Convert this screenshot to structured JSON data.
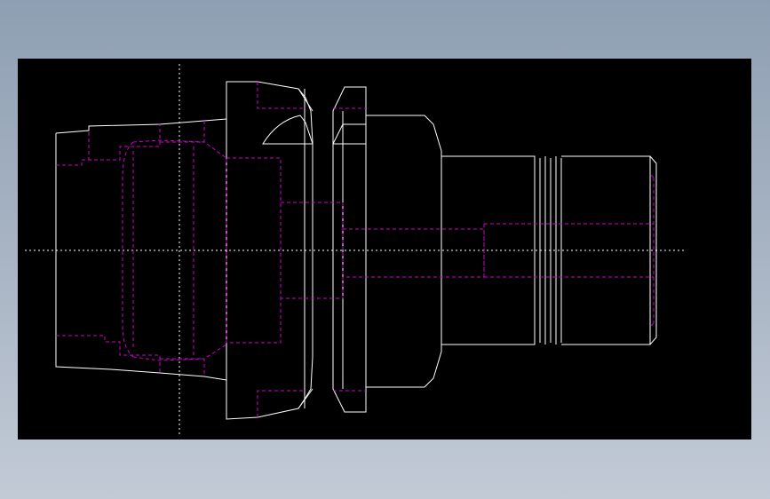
{
  "viewer": {
    "background": "#000000",
    "outside_gradient": [
      "#8f9fb3",
      "#c2cad6"
    ]
  },
  "drawing": {
    "visible_line_color": "#ffffff",
    "hidden_line_color": "#d000d0",
    "center_line_color": "#ffffff"
  }
}
